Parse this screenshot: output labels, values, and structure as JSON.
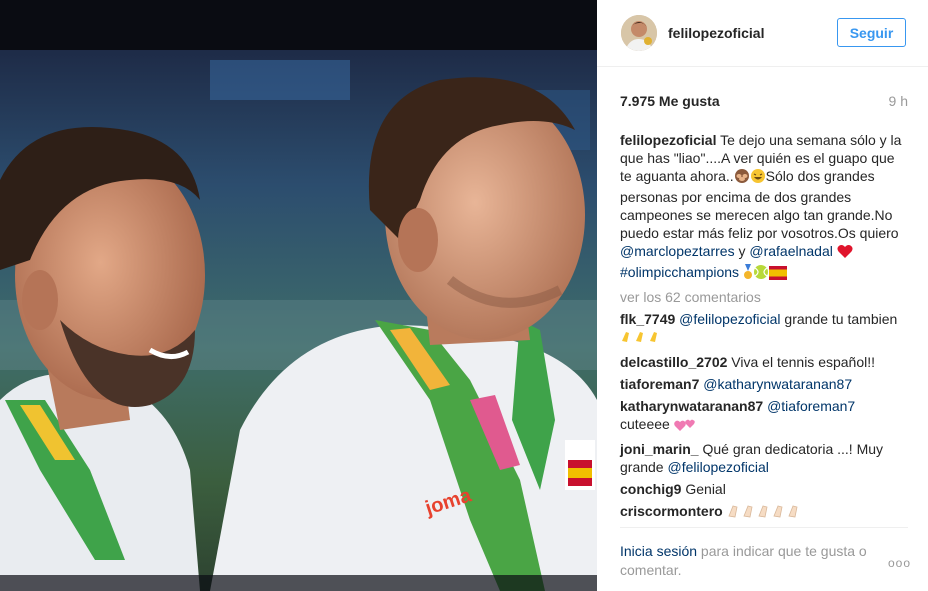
{
  "post": {
    "username": "felilopezoficial",
    "follow_label": "Seguir",
    "likes": "7.975 Me gusta",
    "time": "9 h"
  },
  "caption": {
    "user": "felilopezoficial",
    "text1": " Te dejo una semana sólo y la que has \"liao\"....A ver quién es el guapo que te aguanta ahora..",
    "text2": "Sólo dos grandes personas por encima de dos grandes campeones se merecen algo tan grande.No puedo estar más feliz por vosotros.Os quiero ",
    "mention1": "@marclopeztarres",
    "conj": " y ",
    "mention2": "@rafaelnadal",
    "hashtag": "#olimpicchampions"
  },
  "view_all": "ver los 62 comentarios",
  "comments": [
    {
      "user": "flk_7749",
      "mention": "@felilopezoficial",
      "text": " grande tu tambien "
    },
    {
      "user": "delcastillo_2702",
      "text": " Viva el tennis español!!"
    },
    {
      "user": "tiaforeman7",
      "mention": "@katharynwataranan87"
    },
    {
      "user": "katharynwataranan87",
      "mention": "@tiaforeman7",
      "text": " cuteeee "
    },
    {
      "user": "joni_marin_",
      "text": " Qué gran dedicatoria ...! Muy grande ",
      "mention": "@felilopezoficial"
    },
    {
      "user": "conchig9",
      "text": " Genial"
    },
    {
      "user": "criscormontero",
      "text": " "
    }
  ],
  "footer": {
    "login_link": "Inicia sesión",
    "rest": " para indicar que te gusta o comentar.",
    "more": "ooo"
  },
  "icons": [
    "monkey-emoji-icon",
    "smile-emoji-icon",
    "heart-emoji-icon",
    "medal-emoji-icon",
    "tennis-ball-emoji-icon",
    "spain-flag-emoji-icon",
    "clap-emoji-icon",
    "hearts-emoji-icon",
    "more-options-icon"
  ]
}
